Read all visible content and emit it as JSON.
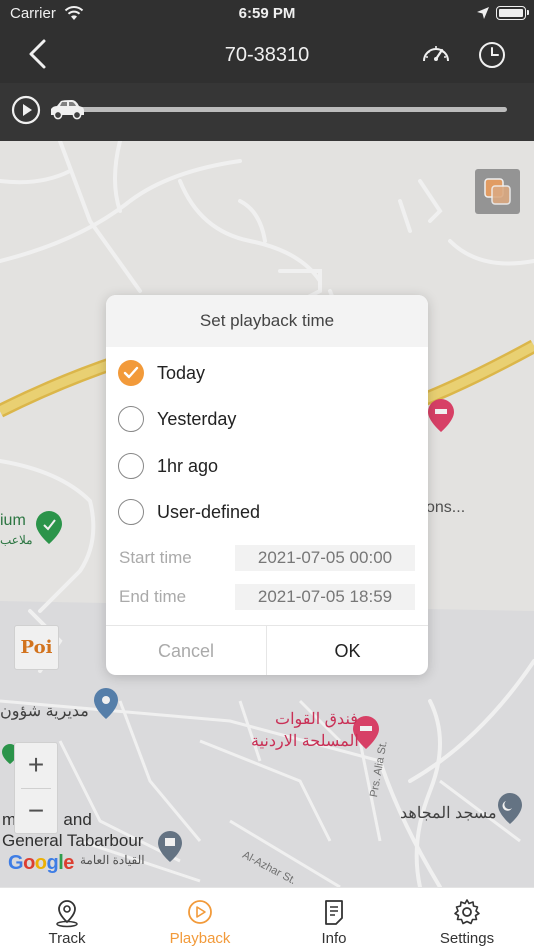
{
  "status_bar": {
    "carrier": "Carrier",
    "time": "6:59 PM"
  },
  "nav": {
    "title": "70-38310",
    "back_icon": "chevron-left-icon",
    "speed_icon": "speedometer-icon",
    "clock_icon": "clock-icon"
  },
  "playback": {
    "progress": 0
  },
  "map": {
    "labels": {
      "poi_button": "Poi",
      "truncated_place": "ons...",
      "ium": "ium",
      "ium_sub": "ملاعب",
      "directorate": "مديرية شؤون",
      "hotel_line1": "فندق القوات",
      "hotel_line2": "المسلحة الاردنية",
      "mosque": "مسجد المجاهد",
      "command_line1": "mmand and",
      "command_line2": "General Tabarbour",
      "command_line3": "القيادة العامة",
      "street_alia": "Prs. Alia St.",
      "street_azhar": "Al-Azhar St.",
      "google": "Google"
    },
    "zoom_in": "+",
    "zoom_out": "−"
  },
  "dialog": {
    "title": "Set playback time",
    "options": [
      {
        "label": "Today",
        "checked": true
      },
      {
        "label": "Yesterday",
        "checked": false
      },
      {
        "label": "1hr ago",
        "checked": false
      },
      {
        "label": "User-defined",
        "checked": false
      }
    ],
    "start_label": "Start time",
    "start_value": "2021-07-05 00:00",
    "end_label": "End time",
    "end_value": "2021-07-05 18:59",
    "cancel": "Cancel",
    "ok": "OK"
  },
  "tabs": [
    {
      "label": "Track",
      "icon": "map-pin-icon",
      "active": false
    },
    {
      "label": "Playback",
      "icon": "play-circle-icon",
      "active": true
    },
    {
      "label": "Info",
      "icon": "document-icon",
      "active": false
    },
    {
      "label": "Settings",
      "icon": "gear-icon",
      "active": false
    }
  ],
  "colors": {
    "accent": "#f29a3a",
    "topbar": "#333333",
    "road": "#f6d76b",
    "poi_pink": "#e5446d",
    "poi_green": "#2e9e4f"
  }
}
